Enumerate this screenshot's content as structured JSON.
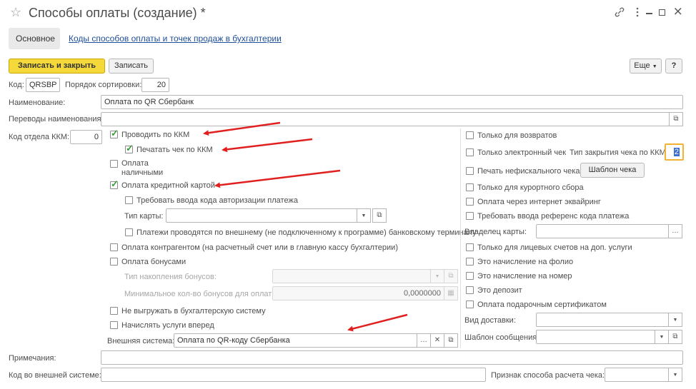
{
  "window": {
    "title": "Способы оплаты (создание) *",
    "star_icon": "star-icon",
    "link_icon": "link-icon",
    "menu_icon": "more-vertical-icon",
    "minimize_icon": "minimize-icon",
    "maximize_icon": "maximize-icon",
    "close_icon": "close-icon"
  },
  "tabs": [
    {
      "label": "Основное"
    },
    {
      "label": "Коды способов оплаты и точек продаж в бухгалтерии"
    }
  ],
  "toolbar": {
    "save_close": "Записать и закрыть",
    "save": "Записать",
    "more": "Еще",
    "help": "?"
  },
  "fields": {
    "code_label": "Код:",
    "code_value": "QRSBP",
    "sort_label": "Порядок сортировки:",
    "sort_value": "20",
    "name_label": "Наименование:",
    "name_value": "Оплата по QR Сбербанк",
    "translations_label": "Переводы наименования:",
    "translations_value": "",
    "dept_label": "Код отдела ККМ:",
    "dept_value": "0",
    "notes_label": "Примечания:",
    "notes_value": "",
    "ext_code_label": "Код во внешней системе:",
    "ext_code_value": "",
    "calc_sign_label": "Признак способа расчета чека:",
    "calc_sign_value": ""
  },
  "left": {
    "kkm": "Проводить по ККМ",
    "print_check": "Печатать чек по ККМ",
    "cash": "Оплата наличными",
    "card": "Оплата кредитной картой",
    "auth_code": "Требовать ввода кода авторизации платежа",
    "card_type_label": "Тип карты:",
    "card_type_value": "",
    "external_terminal": "Платежи проводятся по внешнему (не подключенному к программе) банковскому терминалу",
    "contragent": "Оплата контрагентом (на расчетный счет или в главную кассу бухгалтерии)",
    "bonuses": "Оплата бонусами",
    "bonus_type_label": "Тип накопления бонусов:",
    "bonus_type_value": "",
    "bonus_min_label": "Минимальное кол-во бонусов для оплаты:",
    "bonus_min_value": "0,0000000",
    "no_export": "Не выгружать в бухгалтерскую систему",
    "charge_ahead": "Начислять услуги вперед",
    "ext_system_label": "Внешняя система:",
    "ext_system_value": "Оплата по QR-коду Сбербанка"
  },
  "right": {
    "returns_only": "Только для возвратов",
    "electronic_only": "Только электронный чек",
    "close_type_label": "Тип закрытия чека по ККМ:",
    "close_type_value": "2",
    "nonfiscal": "Печать нефискального чека",
    "template_btn": "Шаблон чека",
    "resort_fee": "Только для курортного сбора",
    "internet_acquiring": "Оплата через интернет эквайринг",
    "ref_code": "Требовать ввода референс кода платежа",
    "card_owner_label": "Владелец карты:",
    "card_owner_value": "",
    "personal_accounts": "Только для лицевых счетов на доп. услуги",
    "folio_charge": "Это начисление на фолио",
    "room_charge": "Это начисление на номер",
    "deposit": "Это депозит",
    "gift_cert": "Оплата подарочным сертификатом",
    "delivery_label": "Вид доставки:",
    "delivery_value": "",
    "msg_template_label": "Шаблон сообщения:",
    "msg_template_value": ""
  },
  "colors": {
    "accent_yellow": "#f5d93b",
    "link_blue": "#1f4e9a",
    "check_green": "#3a9c3a",
    "arrow_red": "#e0201f",
    "focus_orange": "#f2b233"
  }
}
